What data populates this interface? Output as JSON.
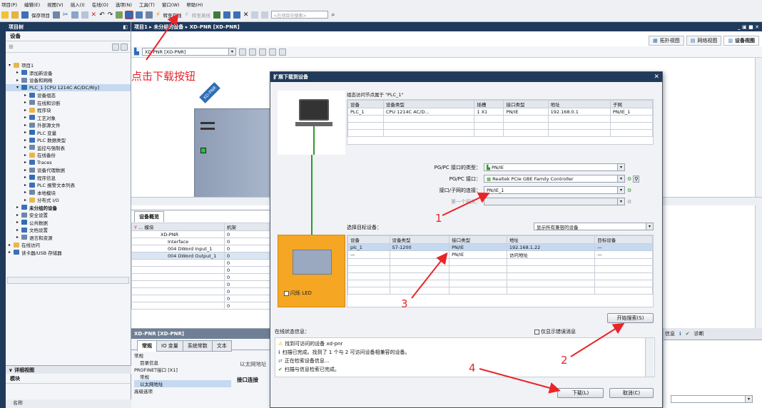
{
  "menu": [
    "项目(P)",
    "编辑(E)",
    "视图(V)",
    "插入(I)",
    "在线(O)",
    "选项(N)",
    "工具(T)",
    "窗口(W)",
    "帮助(H)"
  ],
  "toolbar": {
    "save_label": "保存项目",
    "go_online_label": "转至在线",
    "go_offline_label": "转至离线",
    "search_placeholder": "<在项目中搜索>"
  },
  "project_tree": {
    "title": "项目树",
    "devices_tab": "设备",
    "items": [
      {
        "label": "项目1",
        "indent": 0
      },
      {
        "label": "添加新设备",
        "indent": 1
      },
      {
        "label": "设备和网络",
        "indent": 1
      },
      {
        "label": "PLC_1 [CPU 1214C AC/DC/Rly]",
        "indent": 1
      },
      {
        "label": "设备组态",
        "indent": 2
      },
      {
        "label": "在线和诊断",
        "indent": 2
      },
      {
        "label": "程序块",
        "indent": 2
      },
      {
        "label": "工艺对象",
        "indent": 2
      },
      {
        "label": "外部源文件",
        "indent": 2
      },
      {
        "label": "PLC 变量",
        "indent": 2
      },
      {
        "label": "PLC 数据类型",
        "indent": 2
      },
      {
        "label": "监控与强制表",
        "indent": 2
      },
      {
        "label": "在线备份",
        "indent": 2
      },
      {
        "label": "Traces",
        "indent": 2
      },
      {
        "label": "设备代理数据",
        "indent": 2
      },
      {
        "label": "程序信息",
        "indent": 2
      },
      {
        "label": "PLC 报警文本列表",
        "indent": 2
      },
      {
        "label": "本地模块",
        "indent": 2
      },
      {
        "label": "分布式 I/O",
        "indent": 2
      },
      {
        "label": "未分组的设备",
        "indent": 1
      },
      {
        "label": "安全设置",
        "indent": 1
      },
      {
        "label": "公共数据",
        "indent": 1
      },
      {
        "label": "文档设置",
        "indent": 1
      },
      {
        "label": "语言和资源",
        "indent": 1
      },
      {
        "label": "在线访问",
        "indent": 0
      },
      {
        "label": "读卡器/USB 存储器",
        "indent": 0
      }
    ],
    "details_title": "详细视图",
    "details_col": "模块",
    "details_name_col": "名称"
  },
  "breadcrumb": [
    "项目1",
    "未分组的设备",
    "XD-PNR [XD-PNR]"
  ],
  "views": {
    "topology": "拓扑视图",
    "network": "网络视图",
    "device": "设备视图"
  },
  "device_select": "XD-PNR [XD-PNR]",
  "device_label": "XD-PNR",
  "overview": {
    "title": "设备概览",
    "headers": [
      "模块",
      "机架"
    ],
    "rows": [
      [
        "XD-PNR",
        "0"
      ],
      [
        "Interface",
        "0"
      ],
      [
        "004 DWord Input_1",
        "0"
      ],
      [
        "004 DWord Output_1",
        "0"
      ],
      [
        "",
        "0"
      ],
      [
        "",
        "0"
      ],
      [
        "",
        "0"
      ],
      [
        "",
        "0"
      ],
      [
        "",
        "0"
      ],
      [
        "",
        "0"
      ],
      [
        "",
        "0"
      ]
    ]
  },
  "props": {
    "device": "XD-PNR [XD-PNR]",
    "tabs": [
      "常规",
      "IO 变量",
      "系统常数",
      "文本"
    ],
    "nav": [
      "常规",
      "目录信息",
      "PROFINET接口 [X1]",
      "常规",
      "以太网地址",
      "高级选项"
    ],
    "content_title": "以太网地址",
    "content_sub": "接口连接"
  },
  "info_tabs": {
    "info": "信息",
    "diag": "诊断"
  },
  "dialog": {
    "title": "扩展下载到设备",
    "config_caption": "组态访问节点属于 \"PLC_1\"",
    "config_headers": [
      "设备",
      "设备类型",
      "插槽",
      "接口类型",
      "地址",
      "子网"
    ],
    "config_row": [
      "PLC_1",
      "CPU 1214C AC/D...",
      "1 X1",
      "PN/IE",
      "192.168.0.1",
      "PN/IE_1"
    ],
    "pgpc_type_label": "PG/PC 接口的类型：",
    "pgpc_type_value": "PN/IE",
    "pgpc_if_label": "PG/PC 接口：",
    "pgpc_if_value": "Realtek PCIe GBE Family Controller",
    "subnet_label": "接口/子网的连接：",
    "subnet_value": "PN/IE_1",
    "gateway_label": "第一个网关：",
    "target_label": "选择目标设备：",
    "target_filter": "显示所有兼容的设备",
    "target_headers": [
      "设备",
      "设备类型",
      "接口类型",
      "地址",
      "目标设备"
    ],
    "target_rows": [
      [
        "plc_1",
        "S7-1200",
        "PN/IE",
        "192.168.1.22",
        "—"
      ],
      [
        "—",
        "",
        "PN/IE",
        "访问地址",
        "—"
      ]
    ],
    "flash_label": "闪烁 LED",
    "search_btn": "开始搜索(S)",
    "status_label": "在线状态信息：",
    "errors_only": "仅显示错误消息",
    "status_lines": [
      "找到可访问的设备 xd-pnr",
      "扫描已完成。找到了 1 个与 2 可访问设备相兼容的设备。",
      "正在检索设备信息...",
      "扫描与信息检索已完成。"
    ],
    "download_btn": "下载(L)",
    "cancel_btn": "取消(C)"
  },
  "annotations": {
    "callout": "点击下载按钮",
    "n1": "1",
    "n2": "2",
    "n3": "3",
    "n4": "4"
  },
  "colors": {
    "title_bar": "#203a5c",
    "panel_bg": "#d4d8df",
    "selection": "#c5d9f1",
    "annotation": "#e8252b",
    "device_body": "#9aa8c0",
    "plc_orange": "#f5a623"
  }
}
